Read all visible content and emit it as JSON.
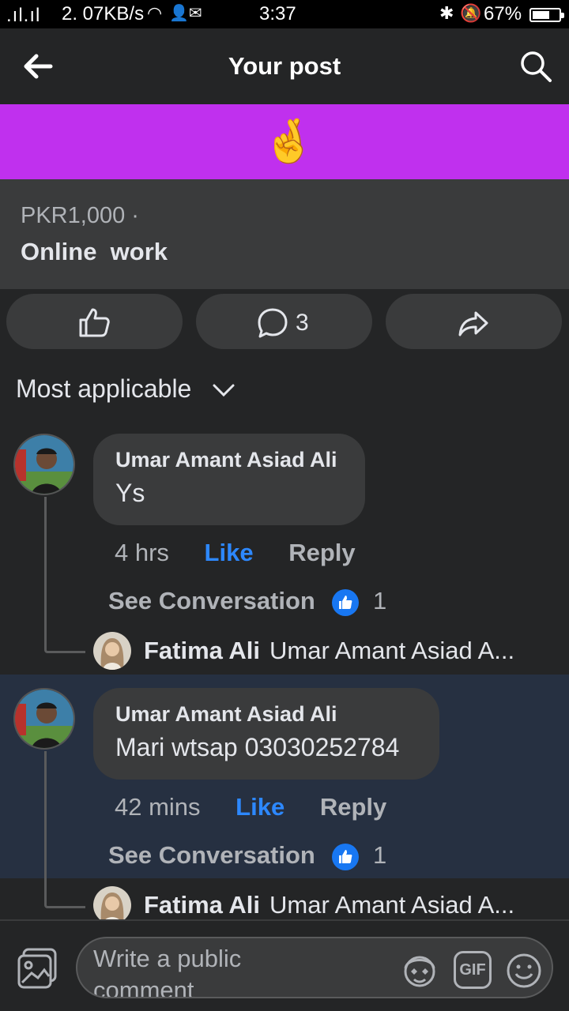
{
  "status_bar": {
    "signal": ".ıl.ıl",
    "network_speed": "2. 07KB/s",
    "time": "3:37",
    "battery_percent": "67%",
    "battery_level": 0.67
  },
  "header": {
    "title": "Your post",
    "back_icon": "arrow-left-icon",
    "search_icon": "search-icon"
  },
  "banner": {
    "emoji": "🤞",
    "color": "#c030ee"
  },
  "listing": {
    "price": "PKR1,000 ·",
    "title": "Online  work"
  },
  "actions": {
    "like_icon": "thumbs-up-icon",
    "comment_icon": "comment-icon",
    "comment_count": "3",
    "share_icon": "share-icon"
  },
  "sort": {
    "label": "Most applicable"
  },
  "comments": [
    {
      "author": "Umar Amant Asiad Ali",
      "text": "Ys",
      "time": "4 hrs",
      "like_label": "Like",
      "reply_label": "Reply",
      "see_conversation": "See Conversation",
      "reaction_count": "1",
      "reply_author": "Fatima Ali",
      "reply_preview": "Umar Amant Asiad A..."
    },
    {
      "author": "Umar Amant Asiad Ali",
      "text": "Mari wtsap 03030252784",
      "time": "42 mins",
      "like_label": "Like",
      "reply_label": "Reply",
      "see_conversation": "See Conversation",
      "reaction_count": "1",
      "reply_author": "Fatima Ali",
      "reply_preview": "Umar Amant Asiad A..."
    }
  ],
  "composer": {
    "placeholder": "Write a public comment",
    "photo_icon": "photo-icon",
    "avatar_sticker_icon": "avatar-sticker-icon",
    "gif_label": "GIF",
    "emoji_icon": "smiley-icon"
  },
  "colors": {
    "background": "#242526",
    "surface": "#3a3b3c",
    "accent_blue": "#2d88ff",
    "highlight_row": "#263041"
  }
}
